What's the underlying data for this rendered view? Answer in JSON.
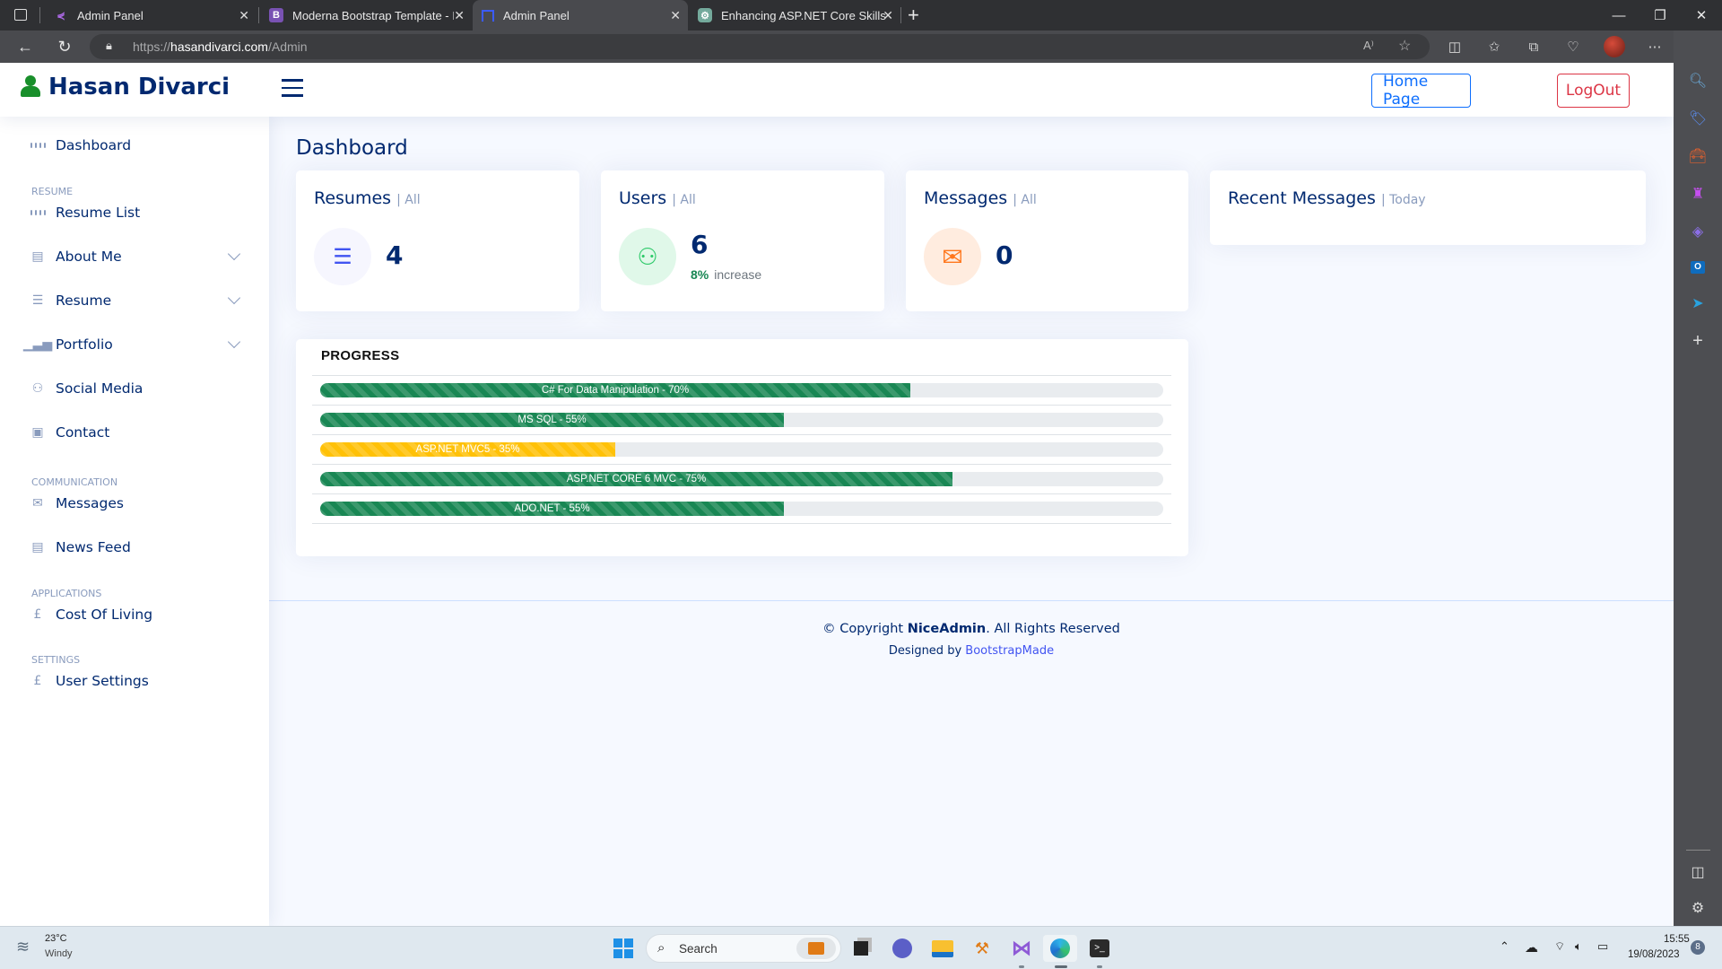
{
  "browser": {
    "tabs": [
      {
        "title": "Admin Panel",
        "icon": "share-nodes-icon",
        "active": false
      },
      {
        "title": "Moderna Bootstrap Template - In",
        "icon": "bootstrap-icon",
        "active": false
      },
      {
        "title": "Admin Panel",
        "icon": "nice-admin-icon",
        "active": true
      },
      {
        "title": "Enhancing ASP.NET Core Skills",
        "icon": "chatgpt-icon",
        "active": false
      }
    ],
    "new_tab_label": "+",
    "url_prefix": "https://",
    "url_host": "hasandivarci.com",
    "url_path": "/Admin",
    "toolbar_icons": [
      "read-aloud-icon",
      "favorite-star-icon",
      "split-screen-icon",
      "favorites-icon",
      "collections-icon",
      "browser-essentials-icon",
      "profile-avatar",
      "more-icon",
      "bing-copilot-icon"
    ],
    "edge_sidebar_icons": [
      "search-icon",
      "shopping-tag-icon",
      "tools-icon",
      "games-icon",
      "microsoft365-icon",
      "outlook-icon",
      "drop-icon",
      "add-icon",
      "hide-sidebar-icon",
      "settings-icon"
    ]
  },
  "header": {
    "logo_text": "Hasan Divarci",
    "home_button": "Home Page",
    "logout_button": "LogOut"
  },
  "sidebar": {
    "items": [
      {
        "label": "Dashboard",
        "icon": "grid-icon"
      },
      {
        "heading": "RESUME"
      },
      {
        "label": "Resume List",
        "icon": "grid-icon"
      },
      {
        "label": "About Me",
        "icon": "journal-icon",
        "expandable": true
      },
      {
        "label": "Resume",
        "icon": "layout-text-icon",
        "expandable": true
      },
      {
        "label": "Portfolio",
        "icon": "bar-chart-icon",
        "expandable": true
      },
      {
        "label": "Social Media",
        "icon": "person-icon"
      },
      {
        "label": "Contact",
        "icon": "contact-card-icon"
      },
      {
        "heading": "COMMUNICATION"
      },
      {
        "label": "Messages",
        "icon": "envelope-icon"
      },
      {
        "label": "News Feed",
        "icon": "list-box-icon"
      },
      {
        "heading": "APPLICATIONS"
      },
      {
        "label": "Cost Of Living",
        "icon": "pound-icon"
      },
      {
        "heading": "SETTINGS"
      },
      {
        "label": "User Settings",
        "icon": "pound-icon"
      }
    ]
  },
  "main": {
    "page_title": "Dashboard",
    "cards": {
      "resumes": {
        "title": "Resumes",
        "filter": "| All",
        "value": "4",
        "icon": "list-icon"
      },
      "users": {
        "title": "Users",
        "filter": "| All",
        "value": "6",
        "change": "8%",
        "change_label": "increase",
        "icon": "people-icon"
      },
      "messages": {
        "title": "Messages",
        "filter": "| All",
        "value": "0",
        "icon": "envelope-icon"
      },
      "recent": {
        "title": "Recent Messages",
        "filter": "| Today"
      }
    },
    "progress": {
      "title": "PROGRESS",
      "bars": [
        {
          "label": "C# For Data Manipulation - 70%",
          "percent": 70,
          "color": "#198754"
        },
        {
          "label": "MS SQL - 55%",
          "percent": 55,
          "color": "#198754"
        },
        {
          "label": "ASP.NET MVC5 - 35%",
          "percent": 35,
          "color": "#ffc107"
        },
        {
          "label": "ASP.NET CORE 6 MVC - 75%",
          "percent": 75,
          "color": "#198754"
        },
        {
          "label": "ADO.NET - 55%",
          "percent": 55,
          "color": "#198754"
        }
      ]
    }
  },
  "footer": {
    "copyright_prefix": "© Copyright ",
    "brand": "NiceAdmin",
    "copyright_suffix": ". All Rights Reserved",
    "designed_by": "Designed by ",
    "designer": "BootstrapMade"
  },
  "taskbar": {
    "weather_temp": "23°C",
    "weather_desc": "Windy",
    "search_placeholder": "Search",
    "time": "15:55",
    "date": "19/08/2023",
    "notification_count": "8"
  },
  "colors": {
    "primary_dark": "#012970",
    "accent_blue": "#4154f1",
    "success": "#198754",
    "warning": "#ffc107",
    "danger": "#dc3545",
    "logo_green": "#198f2b"
  }
}
